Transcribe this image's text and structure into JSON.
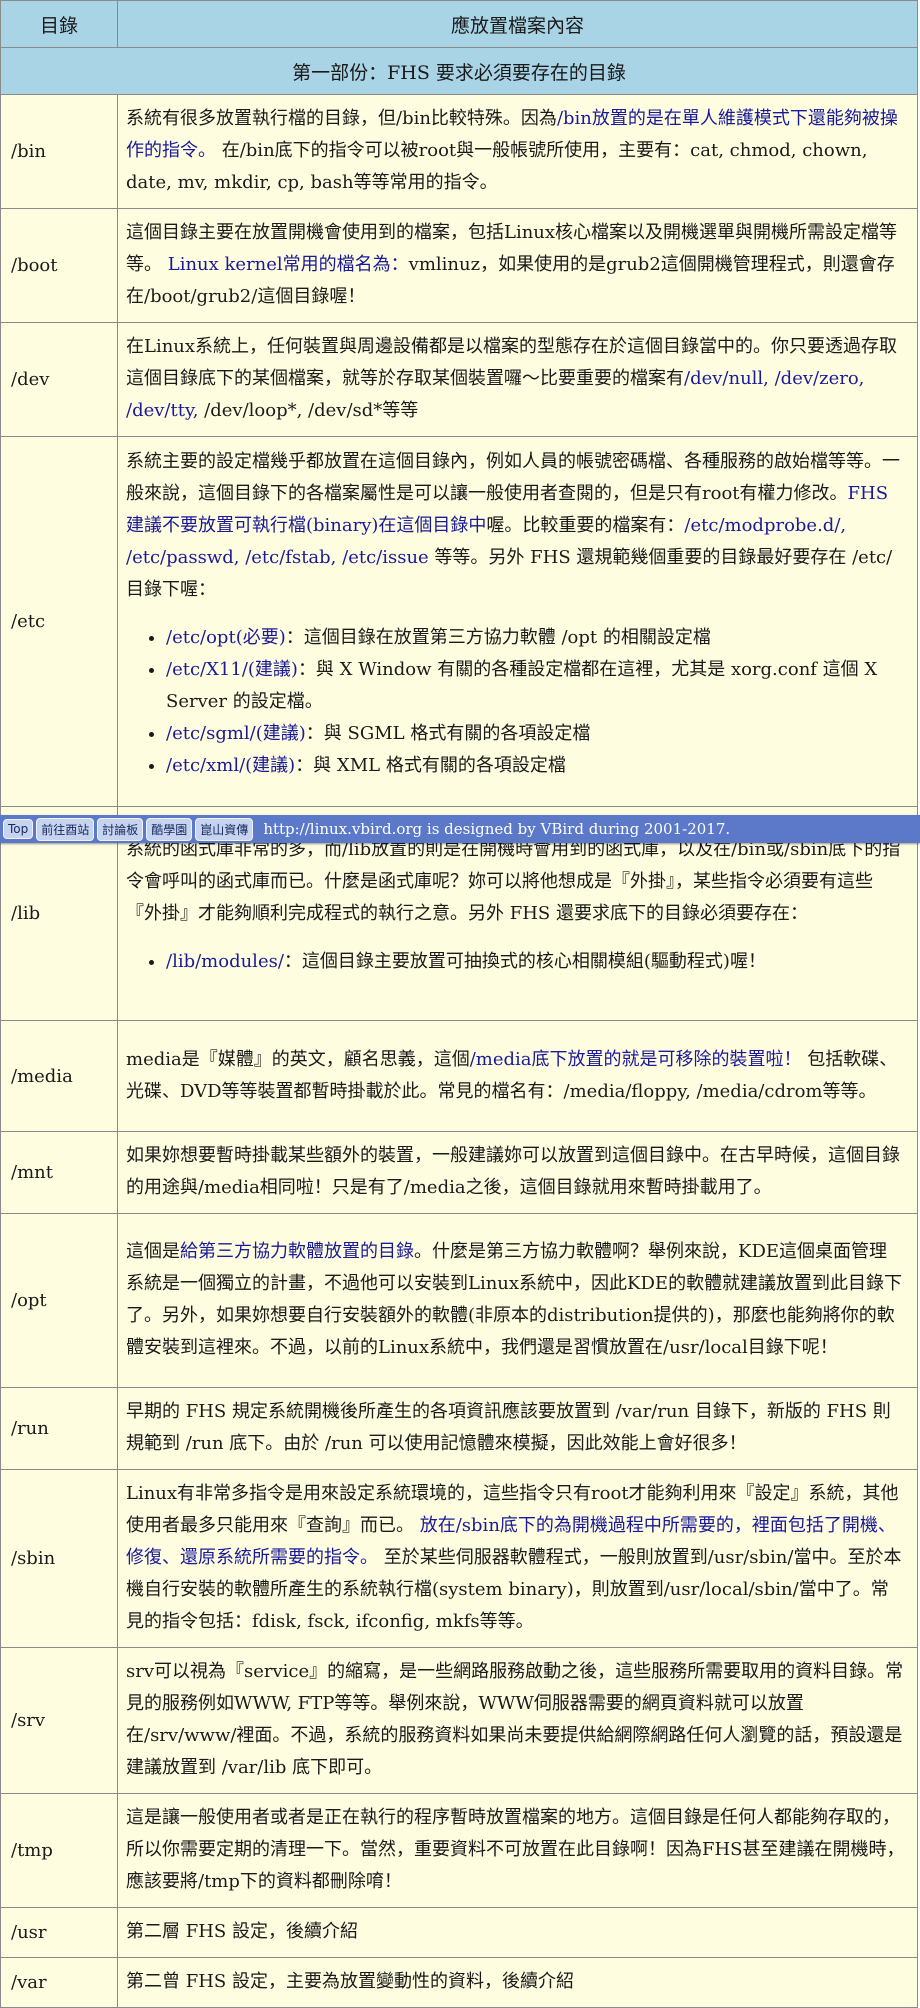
{
  "table": {
    "header": [
      "目錄",
      "應放置檔案內容"
    ],
    "section_title": "第一部份：FHS 要求必須要存在的目錄",
    "rows": [
      {
        "dir": "/bin",
        "h": 109,
        "segments": [
          {
            "t": "系統有很多放置執行檔的目錄，但/bin比較特殊。因為"
          },
          {
            "t": "/bin放置的是在單人維護模式下還能夠被操作的指令。",
            "hl": true
          },
          {
            "t": " 在/bin底下的指令可以被root與一般帳號所使用，主要有：cat, chmod, chown, date, mv, mkdir, cp, bash等等常用的指令。"
          }
        ]
      },
      {
        "dir": "/boot",
        "h": 110,
        "segments": [
          {
            "t": "這個目錄主要在放置開機會使用到的檔案，包括Linux核心檔案以及開機選單與開機所需設定檔等等。 "
          },
          {
            "t": "Linux kernel常用的檔名為：",
            "hl": true
          },
          {
            "t": "vmlinuz，如果使用的是grub2這個開機管理程式，則還會存在/boot/grub2/這個目錄喔！"
          }
        ]
      },
      {
        "dir": "/dev",
        "h": 111,
        "segments": [
          {
            "t": "在Linux系統上，任何裝置與周邊設備都是以檔案的型態存在於這個目錄當中的。你只要透過存取這個目錄底下的某個檔案，就等於存取某個裝置囉～比要重要的檔案有"
          },
          {
            "t": "/dev/null, /dev/zero, /dev/tty,",
            "hl": true
          },
          {
            "t": " /dev/loop*, /dev/sd*等等"
          }
        ]
      },
      {
        "dir": "/etc",
        "h": 370,
        "segments": [
          {
            "t": "系統主要的設定檔幾乎都放置在這個目錄內，例如人員的帳號密碼檔、各種服務的啟始檔等等。一般來說，這個目錄下的各檔案屬性是可以讓一般使用者查閱的，但是只有root有權力修改。"
          },
          {
            "t": "FHS建議不要放置可執行檔(binary)在這個目錄中",
            "hl": true
          },
          {
            "t": "喔。比較重要的檔案有："
          },
          {
            "t": "/etc/modprobe.d/, /etc/passwd, /etc/fstab, /etc/issue",
            "hl": true
          },
          {
            "t": " 等等。另外 FHS 還規範幾個重要的目錄最好要存在 /etc/ 目錄下喔："
          }
        ],
        "list": [
          {
            "hl": "/etc/opt(必要)",
            "t": "：這個目錄在放置第三方協力軟體 /opt 的相關設定檔"
          },
          {
            "hl": "/etc/X11/(建議)",
            "t": "：與 X Window 有關的各種設定檔都在這裡，尤其是 xorg.conf 這個 X Server 的設定檔。"
          },
          {
            "hl": "/etc/sgml/(建議)",
            "t": "：與 SGML 格式有關的各項設定檔"
          },
          {
            "hl": "/etc/xml/(建議)",
            "t": "：與 XML 格式有關的各項設定檔"
          }
        ]
      },
      {
        "dir": "/lib",
        "h": 214,
        "segments": [
          {
            "t": "系統的函式庫非常的多，而/lib放置的則是在開機時會用到的函式庫，以及在/bin或/sbin底下的指令會呼叫的函式庫而已。什麼是函式庫呢？妳可以將他想成是『外掛』，某些指令必須要有這些『外掛』才能夠順利完成程式的執行之意。另外 FHS 還要求底下的目錄必須要存在："
          }
        ],
        "list": [
          {
            "hl": "/lib/modules/",
            "t": "：這個目錄主要放置可抽換式的核心相關模組(驅動程式)喔！"
          }
        ]
      },
      {
        "dir": "/media",
        "h": 111,
        "segments": [
          {
            "t": "media是『媒體』的英文，顧名思義，這個"
          },
          {
            "t": "/media底下放置的就是可移除的裝置啦！",
            "hl": true
          },
          {
            "t": " 包括軟碟、光碟、DVD等等裝置都暫時掛載於此。常見的檔名有：/media/floppy, /media/cdrom等等。"
          }
        ]
      },
      {
        "dir": "/mnt",
        "h": 77,
        "segments": [
          {
            "t": "如果妳想要暫時掛載某些額外的裝置，一般建議妳可以放置到這個目錄中。在古早時候，這個目錄的用途與/media相同啦！只是有了/media之後，這個目錄就用來暫時掛載用了。"
          }
        ]
      },
      {
        "dir": "/opt",
        "h": 174,
        "segments": [
          {
            "t": "這個是"
          },
          {
            "t": "給第三方協力軟體放置的目錄",
            "hl": true
          },
          {
            "t": "。什麼是第三方協力軟體啊？舉例來說，KDE這個桌面管理系統是一個獨立的計畫，不過他可以安裝到Linux系統中，因此KDE的軟體就建議放置到此目錄下了。另外，如果妳想要自行安裝額外的軟體(非原本的distribution提供的)，那麼也能夠將你的軟體安裝到這裡來。不過，以前的Linux系統中，我們還是習慣放置在/usr/local目錄下呢！"
          }
        ]
      },
      {
        "dir": "/run",
        "h": 77,
        "segments": [
          {
            "t": "早期的 FHS 規定系統開機後所產生的各項資訊應該要放置到 /var/run 目錄下，新版的 FHS 則規範到 /run 底下。由於 /run 可以使用記憶體來模擬，因此效能上會好很多！"
          }
        ]
      },
      {
        "dir": "/sbin",
        "h": 173,
        "segments": [
          {
            "t": "Linux有非常多指令是用來設定系統環境的，這些指令只有root才能夠利用來『設定』系統，其他使用者最多只能用來『查詢』而已。 "
          },
          {
            "t": "放在/sbin底下的為開機過程中所需要的，裡面包括了開機、修復、還原系統所需要的指令。",
            "hl": true
          },
          {
            "t": " 至於某些伺服器軟體程式，一般則放置到/usr/sbin/當中。至於本機自行安裝的軟體所產生的系統執行檔(system binary)，則放置到/usr/local/sbin/當中了。常見的指令包括：fdisk, fsck, ifconfig, mkfs等等。"
          }
        ]
      },
      {
        "dir": "/srv",
        "h": 142,
        "segments": [
          {
            "t": "srv可以視為『service』的縮寫，是一些網路服務啟動之後，這些服務所需要取用的資料目錄。常見的服務例如WWW, FTP等等。舉例來說，WWW伺服器需要的網頁資料就可以放置在/srv/www/裡面。不過，系統的服務資料如果尚未要提供給網際網路任何人瀏覽的話，預設還是建議放置到 /var/lib 底下即可。"
          }
        ]
      },
      {
        "dir": "/tmp",
        "h": 110,
        "segments": [
          {
            "t": "這是讓一般使用者或者是正在執行的程序暫時放置檔案的地方。這個目錄是任何人都能夠存取的，所以你需要定期的清理一下。當然，重要資料不可放置在此目錄啊！因為FHS甚至建議在開機時，應該要將/tmp下的資料都刪除唷！"
          }
        ]
      },
      {
        "dir": "/usr",
        "h": 45,
        "segments": [
          {
            "t": "第二層 FHS 設定，後續介紹"
          }
        ]
      },
      {
        "dir": "/var",
        "h": 45,
        "segments": [
          {
            "t": "第二曾 FHS 設定，主要為放置變動性的資料，後續介紹"
          }
        ]
      }
    ]
  },
  "navbar": {
    "buttons": [
      "Top",
      "前往酉站",
      "討論板",
      "酷學園",
      "崑山資傳"
    ],
    "text": "http://linux.vbird.org is designed by VBird during 2001-2017."
  },
  "colors": {
    "header_bg": "#a9d4e6",
    "cell_bg": "#fffde0",
    "link": "#1a1a99",
    "navbar_bg": "#5b78c9"
  }
}
